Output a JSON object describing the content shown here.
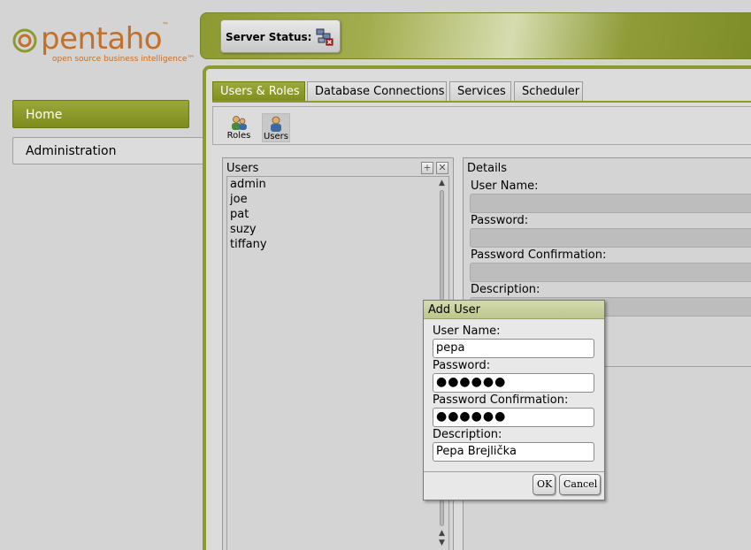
{
  "logo": {
    "name": "pentaho",
    "tm": "™",
    "tagline": "open source business intelligence™"
  },
  "nav": {
    "home": "Home",
    "administration": "Administration"
  },
  "header": {
    "server_status_label": "Server Status:",
    "server_status_icon": "server-error-icon"
  },
  "tabs": [
    {
      "label": "Users & Roles",
      "active": true
    },
    {
      "label": "Database Connections",
      "active": false
    },
    {
      "label": "Services",
      "active": false
    },
    {
      "label": "Scheduler",
      "active": false
    }
  ],
  "toolbar": {
    "roles_label": "Roles",
    "users_label": "Users"
  },
  "users_panel": {
    "title": "Users",
    "add_symbol": "+",
    "remove_symbol": "✕",
    "items": [
      "admin",
      "joe",
      "pat",
      "suzy",
      "tiffany"
    ]
  },
  "details": {
    "title": "Details",
    "user_name_label": "User Name:",
    "password_label": "Password:",
    "password_confirm_label": "Password Confirmation:",
    "description_label": "Description:"
  },
  "dialog": {
    "title": "Add User",
    "user_name_label": "User Name:",
    "user_name_value": "pepa",
    "password_label": "Password:",
    "password_value": "●●●●●●",
    "password_confirm_label": "Password Confirmation:",
    "password_confirm_value": "●●●●●●",
    "description_label": "Description:",
    "description_value": "Pepa Brejlička",
    "ok_label": "OK",
    "cancel_label": "Cancel"
  },
  "colors": {
    "accent": "#8c9a30",
    "logo": "#c2702a"
  }
}
